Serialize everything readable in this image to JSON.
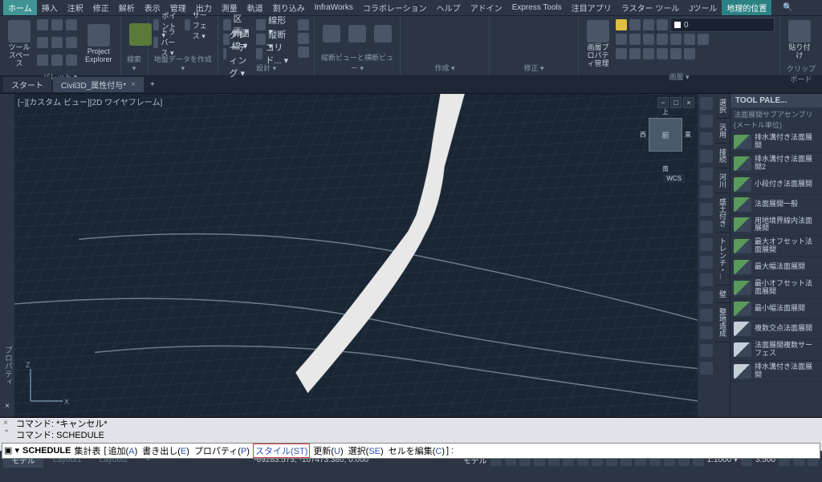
{
  "menubar": {
    "items": [
      "ホーム",
      "挿入",
      "注釈",
      "修正",
      "解析",
      "表示",
      "管理",
      "出力",
      "測量",
      "軌道",
      "割り込み",
      "InfraWorks",
      "コラボレーション",
      "ヘルプ",
      "アドイン",
      "Express Tools",
      "注目アプリ",
      "ラスター ツール",
      "Jツール",
      "地理的位置"
    ],
    "active_index": 0,
    "geo_index": 19
  },
  "ribbon": {
    "panels": [
      {
        "label": "パレット ▾",
        "items": [
          "ツールスペース",
          "Project Explorer"
        ]
      },
      {
        "label": "検索 ▾",
        "items": []
      },
      {
        "label": "地盤データを作成 ▾",
        "rows": [
          "ポイント ▾",
          "サーフェス ▾",
          "トラバース ▾"
        ]
      },
      {
        "label": "設計 ▾",
        "rows": [
          "区画 ▾",
          "計画線 ▾",
          "グレーディング ▾",
          "線形 ▾",
          "縦断 ▾",
          "コリド... ▾"
        ]
      },
      {
        "label": "縦断ビューと横断ビュー ▾",
        "items": []
      },
      {
        "label": "作成 ▾",
        "items": []
      },
      {
        "label": "修正 ▾",
        "items": []
      },
      {
        "label": "画層 ▾",
        "big": "画層プロパティ管理",
        "combo_value": "0"
      },
      {
        "label": "クリップボード",
        "big": "貼り付け"
      }
    ]
  },
  "tabs": {
    "items": [
      "スタート",
      "Civil3D_属性付与*"
    ],
    "active_index": 1,
    "add_label": "+"
  },
  "viewport": {
    "header": "[−][カスタム ビュー][2D ワイヤフレーム]",
    "controls": [
      "−",
      "□",
      "×"
    ],
    "viewcube": {
      "front": "前",
      "n": "上",
      "s": "南",
      "e": "東",
      "w": "西"
    },
    "wcs": "WCS"
  },
  "left_sidebar": {
    "label": "プロパティ"
  },
  "right_tabs": [
    "選択",
    "汎用",
    "接続",
    "河川",
    "盛土付き",
    "トレンチ・...",
    "壁",
    "整地造成"
  ],
  "tool_palette": {
    "title": "TOOL PALE...",
    "subtitle": "法面展開サブアセンブリ(メートル単位)",
    "items": [
      {
        "label": "排水溝付き法面展開"
      },
      {
        "label": "排水溝付き法面展開2"
      },
      {
        "label": "小段付き法面展開"
      },
      {
        "label": "法面展開一般"
      },
      {
        "label": "用地境界線内法面展開"
      },
      {
        "label": "最大オフセット法面展開"
      },
      {
        "label": "最大幅法面展開"
      },
      {
        "label": "最小オフセット法面展開"
      },
      {
        "label": "最小幅法面展開"
      },
      {
        "label": "複数交点法面展開"
      },
      {
        "label": "法面展開複数サーフェス"
      },
      {
        "label": "排水溝付き法面展開"
      }
    ]
  },
  "command": {
    "history": [
      "コマンド: *キャンセル*",
      "コマンド: SCHEDULE"
    ],
    "prompt": "SCHEDULE",
    "label": "集計表",
    "options": [
      {
        "text": "追加",
        "key": "A"
      },
      {
        "text": "書き出し",
        "key": "E"
      },
      {
        "text": "プロパティ",
        "key": "P"
      },
      {
        "text": "スタイル",
        "key": "ST",
        "highlight": true
      },
      {
        "text": "更新",
        "key": "U"
      },
      {
        "text": "選択",
        "key": "SE"
      },
      {
        "text": "セルを編集",
        "key": "C"
      }
    ],
    "bracket_open": "[",
    "bracket_close": "] :"
  },
  "statusbar": {
    "tabs": [
      "モデル",
      "Layout1",
      "Layout2"
    ],
    "active_tab": 0,
    "coords": "-69283.573, -107473.380, 0.000",
    "label_model": "モデル",
    "scale_prefix": "1:1000 ▾",
    "gear": "3.500"
  }
}
